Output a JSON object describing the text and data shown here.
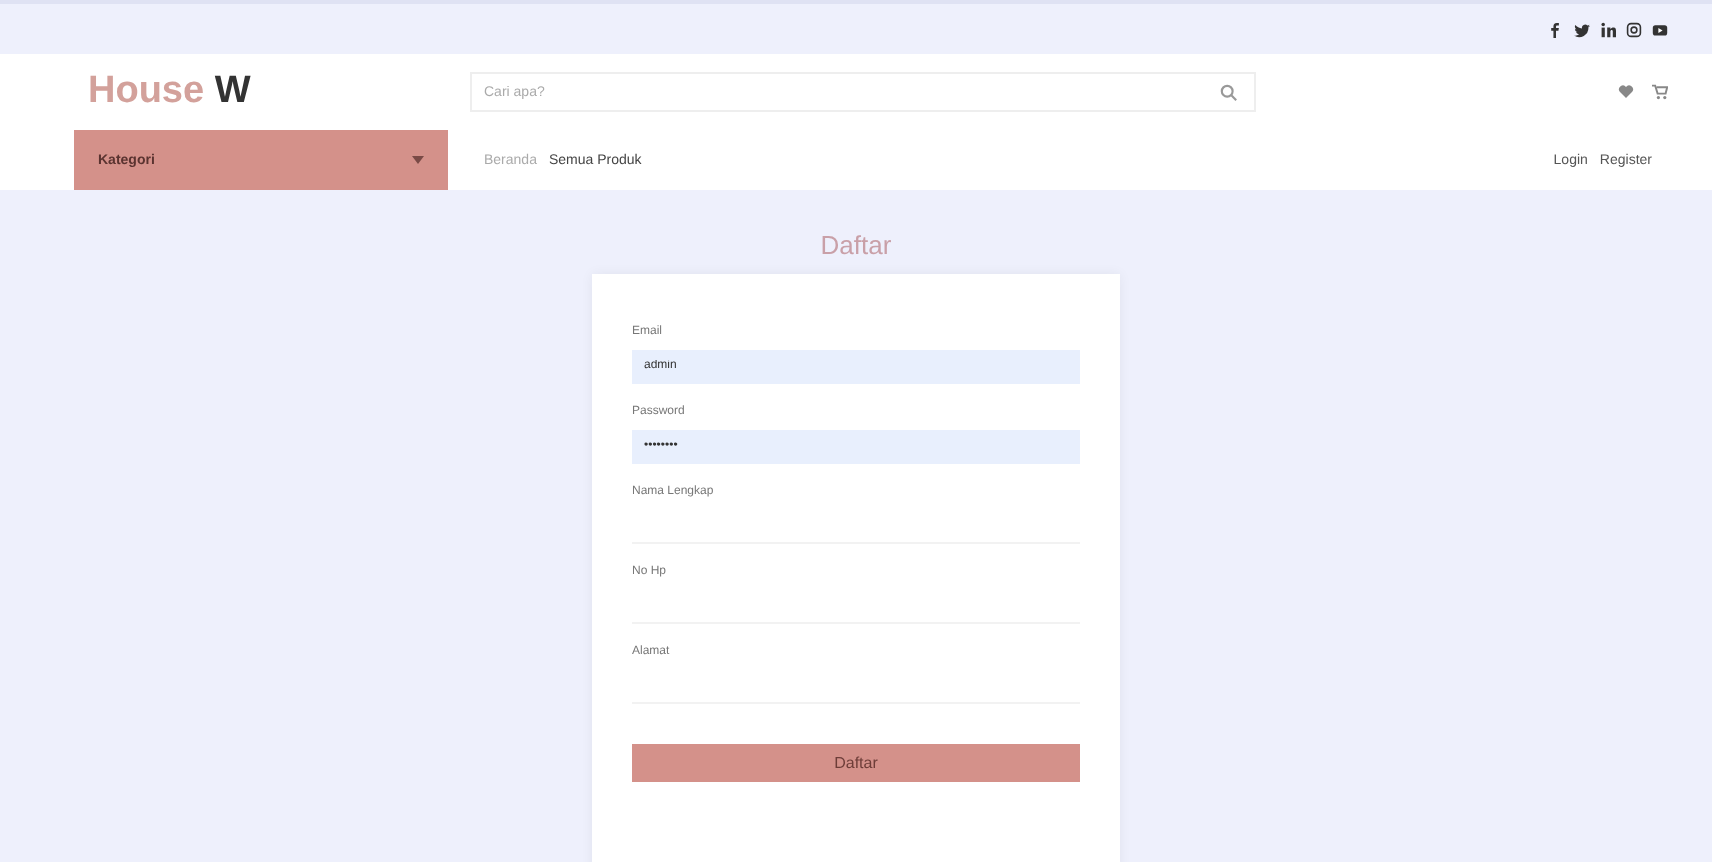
{
  "logo": {
    "part_1": "House",
    "part_2": "W"
  },
  "social": [
    {
      "kind": "facebook"
    },
    {
      "kind": "twitter"
    },
    {
      "kind": "linkedin"
    },
    {
      "kind": "instagram"
    },
    {
      "kind": "youtube"
    }
  ],
  "search": {
    "placeholder": "Cari apa?"
  },
  "category_button": {
    "label": "Kategori"
  },
  "nav": [
    {
      "label": "Beranda",
      "selected": true
    },
    {
      "label": "Semua Produk",
      "selected": false
    }
  ],
  "auth_links": [
    "Login",
    "Register"
  ],
  "form": {
    "title": "Daftar",
    "fields": [
      {
        "label": "Email",
        "value": "admin",
        "filled": true
      },
      {
        "label": "Password",
        "value": "••••••••",
        "filled": true
      },
      {
        "label": "Nama Lengkap",
        "filled": false
      },
      {
        "label": "No Hp",
        "filled": false
      },
      {
        "label": "Alamat",
        "filled": false
      }
    ],
    "submit": "Daftar"
  }
}
